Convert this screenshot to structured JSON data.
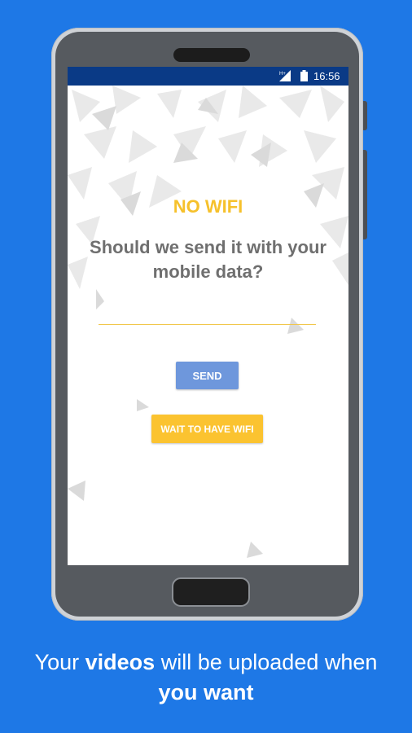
{
  "status_bar": {
    "time": "16:56",
    "signal_icon": "signal-hd-icon",
    "battery_icon": "battery-icon"
  },
  "dialog": {
    "title": "NO WIFI",
    "question": "Should we send it with your mobile data?",
    "input_value": "",
    "send_label": "SEND",
    "wait_label": "WAIT TO HAVE WIFI"
  },
  "caption": {
    "part1": "Your ",
    "bold1": "videos",
    "part2": " will be uploaded when",
    "bold2": "you want"
  },
  "colors": {
    "background": "#1e78e6",
    "status_bar": "#0a3a86",
    "title": "#f6c12c",
    "send_button": "#6e97dc",
    "wait_button": "#fbc330"
  }
}
